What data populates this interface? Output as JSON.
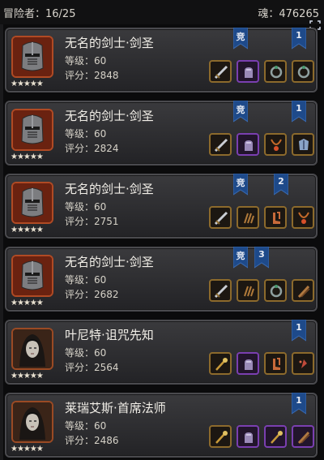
{
  "header": {
    "adventurers": "冒险者：16/25",
    "souls": "魂：476265"
  },
  "cards": [
    {
      "name": "无名的剑士·剑圣",
      "level": "等级：60",
      "score": "评分：2848",
      "stars": "★★★★★",
      "portrait": "helmet",
      "badges": [
        "竞",
        "1"
      ],
      "gear": [
        {
          "type": "sword-icon",
          "rare": false
        },
        {
          "type": "gauntlet-icon",
          "rare": true
        },
        {
          "type": "ring-icon",
          "rare": false
        },
        {
          "type": "ring-icon",
          "rare": false
        }
      ]
    },
    {
      "name": "无名的剑士·剑圣",
      "level": "等级：60",
      "score": "评分：2824",
      "stars": "★★★★★",
      "portrait": "helmet",
      "badges": [
        "竞",
        "1"
      ],
      "gear": [
        {
          "type": "sword-icon",
          "rare": false
        },
        {
          "type": "gauntlet-icon",
          "rare": true
        },
        {
          "type": "amulet-icon",
          "rare": false
        },
        {
          "type": "armor-icon",
          "rare": false
        }
      ]
    },
    {
      "name": "无名的剑士·剑圣",
      "level": "等级：60",
      "score": "评分：2751",
      "stars": "★★★★★",
      "portrait": "helmet",
      "badges": [
        "竞",
        "2"
      ],
      "gear": [
        {
          "type": "sword-icon",
          "rare": false
        },
        {
          "type": "claw-icon",
          "rare": false
        },
        {
          "type": "boots-icon",
          "rare": false
        },
        {
          "type": "amulet-icon",
          "rare": false
        }
      ]
    },
    {
      "name": "无名的剑士·剑圣",
      "level": "等级：60",
      "score": "评分：2682",
      "stars": "★★★★★",
      "portrait": "helmet",
      "badges": [
        "竞",
        "3"
      ],
      "gear": [
        {
          "type": "sword-icon",
          "rare": false
        },
        {
          "type": "claw-icon",
          "rare": false
        },
        {
          "type": "ring-icon",
          "rare": false
        },
        {
          "type": "staff-icon",
          "rare": false
        }
      ]
    },
    {
      "name": "叶尼特·诅咒先知",
      "level": "等级：60",
      "score": "评分：2564",
      "stars": "★★★★★",
      "portrait": "hood",
      "badges": [
        "1"
      ],
      "gear": [
        {
          "type": "wand-icon",
          "rare": false
        },
        {
          "type": "gauntlet-icon",
          "rare": true
        },
        {
          "type": "boots-icon",
          "rare": false
        },
        {
          "type": "shard-icon",
          "rare": false
        }
      ]
    },
    {
      "name": "莱瑞艾斯·首席法师",
      "level": "等级：60",
      "score": "评分：2486",
      "stars": "★★★★★",
      "portrait": "hood",
      "badges": [
        "1"
      ],
      "gear": [
        {
          "type": "wand-icon",
          "rare": false
        },
        {
          "type": "gauntlet-icon",
          "rare": true
        },
        {
          "type": "wand-icon",
          "rare": true
        },
        {
          "type": "staff-icon",
          "rare": true
        }
      ]
    }
  ]
}
